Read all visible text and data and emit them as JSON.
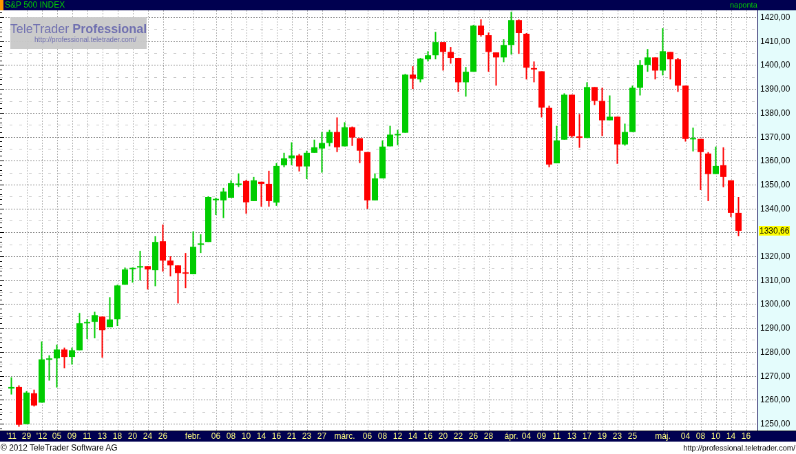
{
  "chart": {
    "title": "S&P 500 INDEX",
    "interval": "naponta",
    "logo": {
      "name": "TeleTrader **Professional**",
      "url": "http://professional.teletrader.com/"
    },
    "last_price": "1330,66",
    "chart_data": {
      "type": "candlestick",
      "grid": true,
      "ylim": [
        1247.1,
        1422.9
      ],
      "categories": [
        "'11",
        null,
        "29",
        null,
        "'12",
        null,
        "05",
        null,
        "09",
        null,
        "11",
        null,
        "13",
        null,
        "18",
        null,
        "20",
        null,
        "24",
        null,
        "26",
        null,
        null,
        null,
        "febr.",
        null,
        null,
        "06",
        null,
        "08",
        null,
        "10",
        null,
        "14",
        null,
        "16",
        null,
        "21",
        null,
        "23",
        null,
        "27",
        null,
        null,
        "márc.",
        null,
        null,
        "06",
        null,
        "08",
        null,
        "12",
        null,
        "14",
        null,
        "16",
        null,
        "20",
        null,
        "22",
        null,
        "26",
        null,
        "28",
        null,
        null,
        "ápr.",
        null,
        "04",
        null,
        "09",
        null,
        "11",
        null,
        "13",
        null,
        "17",
        null,
        "19",
        null,
        "23",
        null,
        "25",
        null,
        null,
        null,
        "máj.",
        null,
        null,
        "04",
        null,
        "08",
        null,
        "10",
        null,
        "14",
        null,
        "16"
      ],
      "yticks": [
        {
          "value": 1420,
          "label": "1420,00"
        },
        {
          "value": 1410,
          "label": "1410,00"
        },
        {
          "value": 1400,
          "label": "1400,00"
        },
        {
          "value": 1390,
          "label": "1390,00"
        },
        {
          "value": 1380,
          "label": "1380,00"
        },
        {
          "value": 1370,
          "label": "1370,00"
        },
        {
          "value": 1360,
          "label": "1360,00"
        },
        {
          "value": 1350,
          "label": "1350,00"
        },
        {
          "value": 1340,
          "label": "1340,00"
        },
        {
          "value": 1320,
          "label": "1320,00"
        },
        {
          "value": 1310,
          "label": "1310,00"
        },
        {
          "value": 1300,
          "label": "1300,00"
        },
        {
          "value": 1290,
          "label": "1290,00"
        },
        {
          "value": 1280,
          "label": "1280,00"
        },
        {
          "value": 1270,
          "label": "1270,00"
        },
        {
          "value": 1260,
          "label": "1260,00"
        },
        {
          "value": 1250,
          "label": "1250,00"
        }
      ],
      "ohlc": [
        [
          1264.8,
          1269.4,
          1262.2,
          1265.2
        ],
        [
          1265.3,
          1266,
          1248.7,
          1249.5
        ],
        [
          1249.8,
          1263.6,
          1249.8,
          1263
        ],
        [
          1262.7,
          1264.2,
          1257.2,
          1257.6
        ],
        [
          1258.8,
          1284.4,
          1258.8,
          1276.9
        ],
        [
          1276.8,
          1278.6,
          1268,
          1277.2
        ],
        [
          1277.3,
          1283,
          1265.1,
          1281
        ],
        [
          1281,
          1281.8,
          1273.2,
          1277.9
        ],
        [
          1277.9,
          1281.8,
          1274.7,
          1280.7
        ],
        [
          1280.7,
          1296.3,
          1280.7,
          1292
        ],
        [
          1292.1,
          1293.7,
          1285.4,
          1292.4
        ],
        [
          1292.6,
          1296.8,
          1285.7,
          1295.4
        ],
        [
          1294.8,
          1294.8,
          1277.6,
          1289.1
        ],
        [
          1290.3,
          1302.9,
          1290.3,
          1293.6
        ],
        [
          1293.7,
          1308.1,
          1290.9,
          1307.8
        ],
        [
          1308.1,
          1315.3,
          1308.1,
          1314.5
        ],
        [
          1314.8,
          1315.3,
          1309,
          1315
        ],
        [
          1315.5,
          1322.3,
          1309.9,
          1315.7
        ],
        [
          1315.9,
          1315.9,
          1306.1,
          1314.5
        ],
        [
          1314.2,
          1328.4,
          1307.5,
          1326
        ],
        [
          1326.3,
          1333.3,
          1313.6,
          1318.2
        ],
        [
          1318.2,
          1320,
          1311.6,
          1316.2
        ],
        [
          1316.2,
          1316.2,
          1300.3,
          1313
        ],
        [
          1313.1,
          1321.4,
          1306.7,
          1312.9
        ],
        [
          1312.5,
          1330.4,
          1312.5,
          1324
        ],
        [
          1325,
          1329.2,
          1321.4,
          1325.2
        ],
        [
          1326,
          1345.1,
          1326,
          1344.8
        ],
        [
          1343.5,
          1344.5,
          1337.3,
          1344
        ],
        [
          1343.4,
          1348.6,
          1336,
          1347.1
        ],
        [
          1344.5,
          1351.8,
          1344.5,
          1350.6
        ],
        [
          1350,
          1354.7,
          1349,
          1350.3
        ],
        [
          1351.5,
          1352,
          1337.8,
          1342.6
        ],
        [
          1343.1,
          1353.2,
          1343.1,
          1351.8
        ],
        [
          1351.2,
          1351.2,
          1340.8,
          1350.3
        ],
        [
          1350.3,
          1355.8,
          1340.8,
          1343.1
        ],
        [
          1342.5,
          1359,
          1341.1,
          1357.8
        ],
        [
          1358.1,
          1363.3,
          1357.3,
          1361
        ],
        [
          1361,
          1367.7,
          1358.1,
          1362.2
        ],
        [
          1362.2,
          1362.8,
          1355.5,
          1357.6
        ],
        [
          1357.6,
          1364.2,
          1352.3,
          1363.3
        ],
        [
          1363.3,
          1368.8,
          1363.3,
          1365.6
        ],
        [
          1365.1,
          1372,
          1355,
          1367.4
        ],
        [
          1367.4,
          1372.9,
          1366,
          1372
        ],
        [
          1372,
          1378.1,
          1363.6,
          1365.6
        ],
        [
          1366,
          1376.1,
          1366,
          1374
        ],
        [
          1374,
          1374.3,
          1366.2,
          1369.7
        ],
        [
          1369.4,
          1369.4,
          1359,
          1364.2
        ],
        [
          1363.6,
          1363.6,
          1339.9,
          1343.4
        ],
        [
          1343.4,
          1354.7,
          1343.4,
          1352.6
        ],
        [
          1352.6,
          1368.5,
          1352.6,
          1365.9
        ],
        [
          1366,
          1374.6,
          1366,
          1370.9
        ],
        [
          1370.8,
          1372.9,
          1366.5,
          1371
        ],
        [
          1371.7,
          1396.3,
          1371.7,
          1396
        ],
        [
          1396,
          1399.5,
          1390,
          1394.3
        ],
        [
          1394,
          1403,
          1392.8,
          1402.7
        ],
        [
          1402.4,
          1405.8,
          1401.5,
          1404.1
        ],
        [
          1404.1,
          1413.9,
          1402.4,
          1409.6
        ],
        [
          1409.6,
          1409.6,
          1397.7,
          1405.5
        ],
        [
          1405.5,
          1407.6,
          1400.6,
          1403
        ],
        [
          1403,
          1403,
          1388.8,
          1392.8
        ],
        [
          1392.8,
          1399.2,
          1386.8,
          1397.2
        ],
        [
          1397.2,
          1416.8,
          1397.2,
          1416.5
        ],
        [
          1416.5,
          1419.1,
          1411.9,
          1412.5
        ],
        [
          1412.5,
          1413.6,
          1397.2,
          1405.5
        ],
        [
          1405.3,
          1405.3,
          1391.4,
          1403.2
        ],
        [
          1403.2,
          1410.8,
          1401.2,
          1408.4
        ],
        [
          1408.4,
          1422.3,
          1404.4,
          1418.8
        ],
        [
          1418.8,
          1419.1,
          1404.7,
          1413.4
        ],
        [
          1413.1,
          1413.4,
          1394,
          1398.9
        ],
        [
          1398.6,
          1401.5,
          1392.8,
          1398.3
        ],
        [
          1397.4,
          1397.4,
          1378.1,
          1382.2
        ],
        [
          1382.1,
          1383,
          1357.3,
          1358.4
        ],
        [
          1358.9,
          1374.6,
          1358.9,
          1368.5
        ],
        [
          1368.8,
          1388.2,
          1368.8,
          1387.6
        ],
        [
          1387.6,
          1387.6,
          1369.7,
          1370.3
        ],
        [
          1370,
          1379.5,
          1365.4,
          1369.7
        ],
        [
          1369.5,
          1392.8,
          1369.5,
          1390.8
        ],
        [
          1390.8,
          1390.8,
          1383.3,
          1385
        ],
        [
          1385,
          1390.5,
          1370.3,
          1376.9
        ],
        [
          1376.9,
          1387.3,
          1376.9,
          1378.4
        ],
        [
          1378.4,
          1378.4,
          1358.7,
          1366.8
        ],
        [
          1366.8,
          1375.5,
          1366.3,
          1372
        ],
        [
          1372,
          1391.4,
          1372,
          1390.5
        ],
        [
          1390.5,
          1402.1,
          1387.3,
          1400.1
        ],
        [
          1400.1,
          1406.7,
          1397.2,
          1403.2
        ],
        [
          1403.2,
          1403.2,
          1394,
          1397.7
        ],
        [
          1397.7,
          1415.4,
          1395.7,
          1405.8
        ],
        [
          1405.5,
          1405.5,
          1394,
          1402.4
        ],
        [
          1402.4,
          1403,
          1388.8,
          1391.4
        ],
        [
          1391.4,
          1391.4,
          1368,
          1369.1
        ],
        [
          1369.1,
          1373.8,
          1363.9,
          1369.3
        ],
        [
          1369.1,
          1369.1,
          1347.7,
          1363.6
        ],
        [
          1363,
          1363.6,
          1343.1,
          1354.4
        ],
        [
          1354.4,
          1365.9,
          1354.4,
          1357.8
        ],
        [
          1358.1,
          1365.6,
          1348.9,
          1353.2
        ],
        [
          1351.8,
          1351.8,
          1336.4,
          1338.2
        ],
        [
          1338.2,
          1344.8,
          1328.4,
          1330.66
        ],
        null
      ]
    }
  },
  "footer": {
    "copyright": "© 2012 TeleTrader Software AG",
    "url": "http://professional.teletrader.com/"
  }
}
